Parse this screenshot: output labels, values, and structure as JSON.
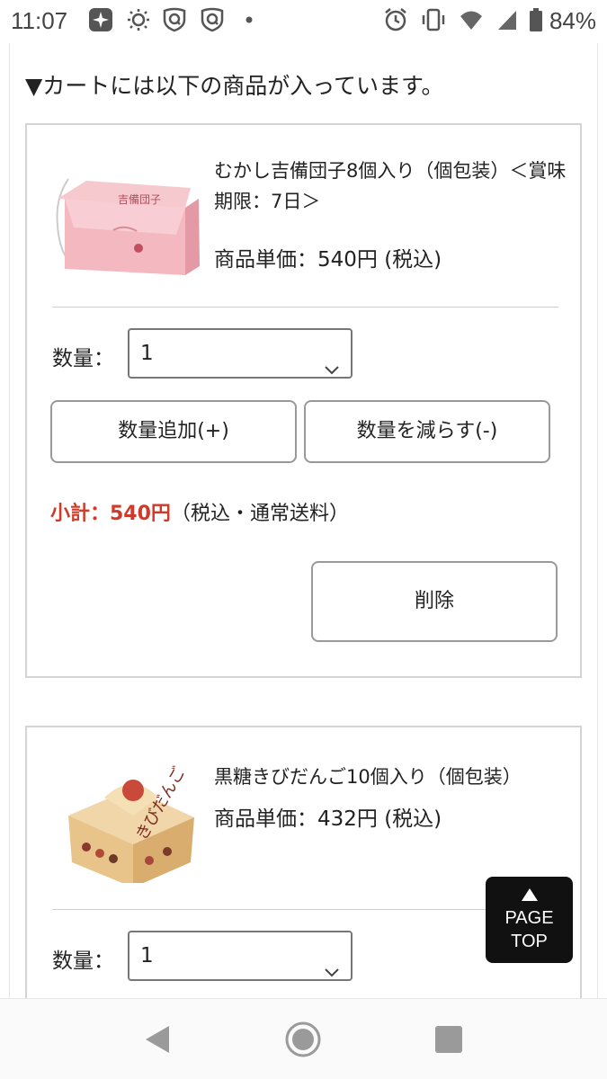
{
  "status_bar": {
    "time": "11:07",
    "battery_percent": "84%"
  },
  "cart": {
    "heading": "▼カートには以下の商品が入っています。",
    "items": [
      {
        "name": "むかし吉備団子8個入り（個包装）＜賞味期限：7日＞",
        "unit_price": "商品単価：540円 (税込)",
        "qty_label": "数量：",
        "qty_value": "1",
        "add_label": "数量追加(+)",
        "sub_label": "数量を減らす(-)",
        "subtotal_label": "小計：540円",
        "subtotal_note": "（税込・通常送料）",
        "delete_label": "削除"
      },
      {
        "name": "黒糖きびだんご10個入り（個包装）",
        "unit_price": "商品単価：432円 (税込)",
        "qty_label": "数量：",
        "qty_value": "1"
      }
    ]
  },
  "page_top": {
    "line1": "PAGE",
    "line2": "TOP"
  },
  "colors": {
    "accent_red": "#d03a2a",
    "page_top_bg": "#111111"
  }
}
